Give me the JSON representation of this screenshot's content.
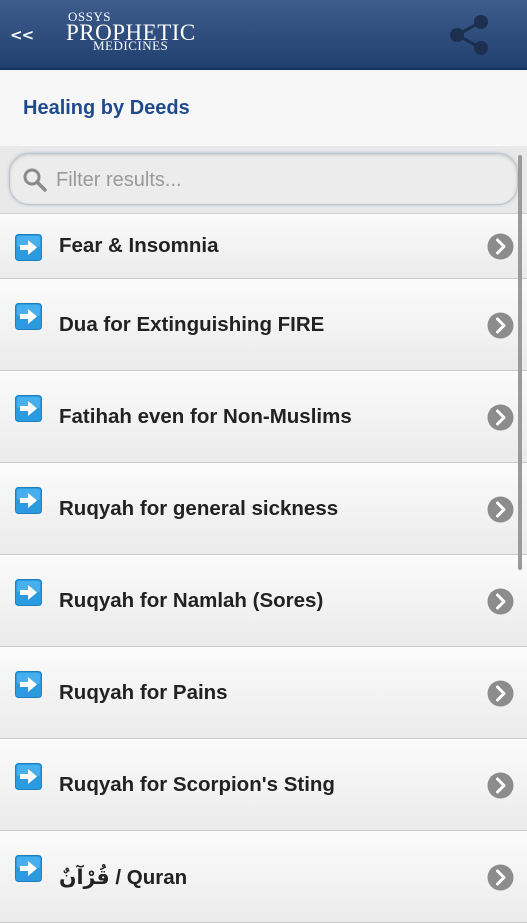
{
  "header": {
    "back_label": "<<",
    "logo_line1": "OSSYS",
    "logo_line2": "PROPHETIC",
    "logo_line3": "MEDICINES",
    "share_icon": "share-icon"
  },
  "page": {
    "title": "Healing by Deeds"
  },
  "search": {
    "placeholder": "Filter results...",
    "value": ""
  },
  "items": [
    {
      "label": "Fear & Insomnia"
    },
    {
      "label": "Dua for Extinguishing FIRE"
    },
    {
      "label": "Fatihah even for Non-Muslims"
    },
    {
      "label": "Ruqyah for general sickness"
    },
    {
      "label": "Ruqyah for Namlah (Sores)"
    },
    {
      "label": "Ruqyah for Pains"
    },
    {
      "label": "Ruqyah for Scorpion's Sting"
    },
    {
      "label": "قُرْآنٌ / Quran"
    }
  ],
  "colors": {
    "header_bg": "#2b4a7b",
    "title_blue": "#1f4b8e",
    "arrow_blue": "#2a9be0",
    "chevron_gray": "#8c8c8c"
  }
}
